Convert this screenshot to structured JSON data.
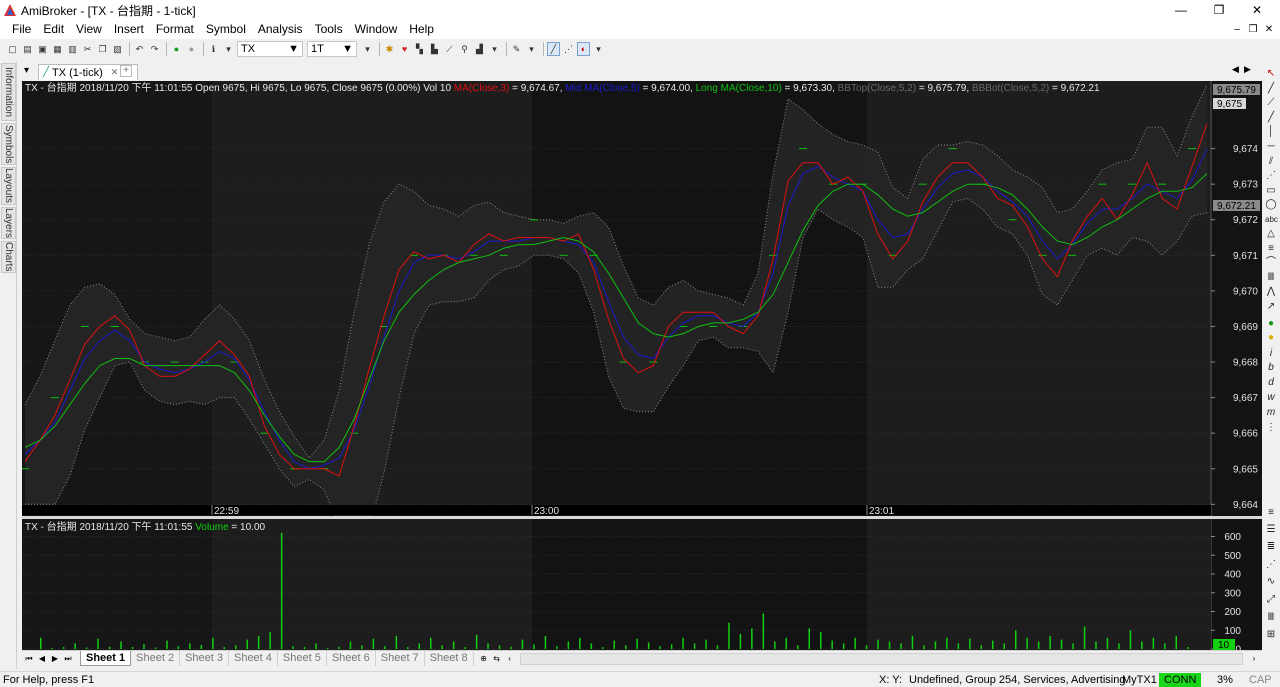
{
  "window": {
    "title": "AmiBroker - [TX - 台指期 - 1-tick]",
    "minimize": "—",
    "restore": "❐",
    "close": "✕"
  },
  "menu": {
    "items": [
      "File",
      "Edit",
      "View",
      "Insert",
      "Format",
      "Symbol",
      "Analysis",
      "Tools",
      "Window",
      "Help"
    ],
    "mdi_min": "–",
    "mdi_restore": "❐",
    "mdi_close": "✕"
  },
  "toolbar": {
    "symbol": "TX",
    "interval": "1T"
  },
  "left_dock": {
    "tabs": [
      "Information",
      "Symbols",
      "Layouts",
      "Layers",
      "Charts"
    ]
  },
  "doc_tab": {
    "label": "TX (1-tick)",
    "close": "✕"
  },
  "chart": {
    "header": {
      "prefix": "TX - 台指期  2018/11/20 下午 11:01:55 Open 9675, Hi 9675, Lo 9675, Close 9675 (0.00%) Vol 10 ",
      "ma_label": "MA(Close,3)",
      "ma_value": " = 9,674.67, ",
      "mid_label": "Mid MA(Close,5)",
      "mid_value": " = 9,674.00, ",
      "long_label": "Long MA(Close,10)",
      "long_value": " = 9,673.30, ",
      "bbtop_label": "BBTop(Close,5,2)",
      "bbtop_value": " = 9,675.79, ",
      "bbbot_label": "BBBot(Close,5,2)",
      "bbbot_value": " = 9,672.21"
    },
    "volume_header": {
      "prefix": "TX - 台指期  2018/11/20 下午  11:01:55  ",
      "label": "Volume",
      "value": " = 10.00"
    },
    "price_ticks": [
      "9,674",
      "9,673",
      "9,672",
      "9,671",
      "9,670",
      "9,669",
      "9,668",
      "9,667",
      "9,666",
      "9,665",
      "9,664"
    ],
    "volume_ticks": [
      "600",
      "500",
      "400",
      "300",
      "200",
      "100",
      "0"
    ],
    "time_labels": [
      "22:59",
      "23:00",
      "23:01"
    ],
    "price_markers": {
      "bbtop": "9,675.79",
      "close": "9,675",
      "bbbot": "9,672.21"
    },
    "volume_marker": "10",
    "colors": {
      "ma": "#e01010",
      "mid": "#1a1ad0",
      "long": "#10c010",
      "bands": "#8a8a8a",
      "volume": "#10d010"
    }
  },
  "sheets": {
    "tabs": [
      "Sheet 1",
      "Sheet 2",
      "Sheet 3",
      "Sheet 4",
      "Sheet 5",
      "Sheet 6",
      "Sheet 7",
      "Sheet 8"
    ],
    "active": "Sheet 1"
  },
  "status": {
    "help": "For Help, press F1",
    "xy": "X:  Y:",
    "info": "Undefined, Group 254, Services, Advertising",
    "account": "MyTX1",
    "conn": "CONN",
    "percent": "3%",
    "caps": "CAP"
  },
  "chart_data": {
    "type": "line",
    "x_labels": [
      "22:59",
      "23:00",
      "23:01"
    ],
    "ylim": [
      9663.7,
      9675.9
    ],
    "series": [
      {
        "name": "MA(Close,3)",
        "values": [
          9665.2,
          9665.8,
          9666.5,
          9667.5,
          9668.5,
          9669.0,
          9669.3,
          9668.9,
          9667.9,
          9667.6,
          9667.6,
          9667.8,
          9668.2,
          9668.6,
          9668.2,
          9667.6,
          9666.2,
          9665.4,
          9665.0,
          9665.0,
          9665.0,
          9664.8,
          9666.2,
          9667.8,
          9669.3,
          9670.6,
          9671.1,
          9670.9,
          9671.0,
          9670.8,
          9671.3,
          9671.6,
          9671.4,
          9671.5,
          9671.5,
          9671.5,
          9671.4,
          9671.6,
          9670.6,
          9669.2,
          9668.1,
          9667.7,
          9667.9,
          9669.0,
          9669.4,
          9669.4,
          9669.4,
          9669.0,
          9668.8,
          9669.3,
          9670.9,
          9673.1,
          9673.6,
          9673.6,
          9673.0,
          9673.2,
          9672.8,
          9671.6,
          9670.9,
          9671.4,
          9672.5,
          9673.2,
          9673.6,
          9673.6,
          9673.2,
          9672.6,
          9672.4,
          9671.8,
          9670.9,
          9670.4,
          9671.4,
          9672.1,
          9672.6,
          9672.0,
          9672.7,
          9673.6,
          9672.6,
          9672.3,
          9673.5,
          9674.7
        ]
      },
      {
        "name": "Mid MA(Close,5)",
        "values": [
          9665.4,
          9665.8,
          9666.3,
          9667.2,
          9668.1,
          9668.6,
          9668.9,
          9668.6,
          9668.0,
          9667.8,
          9667.7,
          9667.8,
          9668.0,
          9668.3,
          9668.1,
          9667.5,
          9666.6,
          9665.8,
          9665.2,
          9665.0,
          9665.1,
          9665.3,
          9666.1,
          9667.3,
          9668.7,
          9670.0,
          9670.8,
          9671.0,
          9671.0,
          9670.9,
          9671.1,
          9671.4,
          9671.4,
          9671.4,
          9671.5,
          9671.5,
          9671.4,
          9671.3,
          9670.8,
          9669.7,
          9668.7,
          9668.2,
          9668.1,
          9668.7,
          9669.1,
          9669.3,
          9669.3,
          9669.1,
          9669.0,
          9669.4,
          9670.5,
          9672.4,
          9673.3,
          9673.5,
          9673.2,
          9673.0,
          9672.8,
          9672.0,
          9671.5,
          9671.6,
          9672.3,
          9672.9,
          9673.3,
          9673.4,
          9673.2,
          9672.8,
          9672.5,
          9672.1,
          9671.4,
          9670.9,
          9671.3,
          9671.9,
          9672.3,
          9672.3,
          9672.6,
          9673.0,
          9672.8,
          9672.6,
          9673.1,
          9674.0
        ]
      },
      {
        "name": "Long MA(Close,10)",
        "values": [
          9665.6,
          9665.8,
          9666.2,
          9666.8,
          9667.4,
          9667.9,
          9668.1,
          9668.1,
          9667.9,
          9667.9,
          9667.9,
          9667.9,
          9667.9,
          9667.9,
          9667.7,
          9667.2,
          9666.5,
          9665.9,
          9665.4,
          9665.2,
          9665.2,
          9665.6,
          9666.4,
          9667.5,
          9668.6,
          9669.4,
          9669.9,
          9670.3,
          9670.6,
          9670.8,
          9670.9,
          9671.0,
          9671.2,
          9671.3,
          9671.3,
          9671.4,
          9671.5,
          9671.4,
          9671.1,
          9670.5,
          9669.8,
          9669.1,
          9668.8,
          9668.7,
          9668.8,
          9669.0,
          9669.1,
          9669.1,
          9669.2,
          9669.4,
          9669.9,
          9670.8,
          9671.7,
          9672.4,
          9672.8,
          9673.0,
          9673.0,
          9672.7,
          9672.3,
          9672.1,
          9672.2,
          9672.5,
          9672.8,
          9673.0,
          9673.0,
          9672.9,
          9672.7,
          9672.3,
          9671.8,
          9671.4,
          9671.3,
          9671.5,
          9671.8,
          9672.0,
          9672.3,
          9672.6,
          9672.8,
          9672.8,
          9672.9,
          9673.3
        ]
      },
      {
        "name": "BBTop(Close,5,2)",
        "values": [
          9666.8,
          9667.6,
          9668.6,
          9669.6,
          9670.1,
          9670.2,
          9669.9,
          9669.2,
          9668.8,
          9668.7,
          9668.6,
          9668.7,
          9669.2,
          9669.6,
          9669.2,
          9668.6,
          9667.5,
          9666.6,
          9665.9,
          9665.3,
          9665.8,
          9667.2,
          9669.4,
          9671.3,
          9672.5,
          9673.0,
          9672.8,
          9672.4,
          9672.3,
          9672.1,
          9672.4,
          9672.5,
          9672.2,
          9672.1,
          9672.0,
          9672.0,
          9671.9,
          9672.1,
          9672.2,
          9671.8,
          9670.7,
          9669.8,
          9669.6,
          9670.1,
          9670.3,
          9670.0,
          9669.9,
          9669.8,
          9669.6,
          9670.5,
          9673.3,
          9675.4,
          9675.1,
          9674.7,
          9674.4,
          9674.2,
          9674.1,
          9673.9,
          9672.9,
          9672.6,
          9673.7,
          9674.1,
          9674.1,
          9674.2,
          9674.1,
          9673.8,
          9673.4,
          9673.2,
          9672.9,
          9672.2,
          9672.3,
          9672.8,
          9673.4,
          9673.6,
          9673.7,
          9674.6,
          9674.6,
          9673.8,
          9674.9,
          9675.8
        ]
      },
      {
        "name": "BBBot(Close,5,2)",
        "values": [
          9664.0,
          9664.0,
          9664.0,
          9664.8,
          9666.1,
          9667.0,
          9667.9,
          9668.0,
          9667.2,
          9666.9,
          9666.8,
          9666.9,
          9666.8,
          9667.0,
          9667.0,
          9666.4,
          9665.7,
          9665.0,
          9664.5,
          9664.7,
          9664.4,
          9663.4,
          9662.8,
          9663.3,
          9664.9,
          9667.0,
          9668.8,
          9669.6,
          9669.7,
          9669.7,
          9669.8,
          9670.3,
          9670.6,
          9670.7,
          9671.0,
          9671.0,
          9670.9,
          9670.5,
          9669.4,
          9667.6,
          9666.7,
          9666.6,
          9666.6,
          9667.3,
          9667.9,
          9668.6,
          9668.7,
          9668.4,
          9668.4,
          9668.3,
          9667.7,
          9669.4,
          9671.5,
          9672.3,
          9672.0,
          9671.8,
          9671.5,
          9670.1,
          9670.1,
          9670.6,
          9670.9,
          9671.7,
          9672.5,
          9672.6,
          9672.3,
          9671.8,
          9671.6,
          9671.0,
          9669.9,
          9669.6,
          9670.3,
          9671.0,
          9671.2,
          9671.0,
          9671.5,
          9671.4,
          9671.0,
          9671.4,
          9672.1,
          9672.2
        ]
      }
    ],
    "volume": {
      "name": "Volume",
      "ylim": [
        0,
        640
      ],
      "values": [
        60,
        5,
        10,
        30,
        8,
        55,
        12,
        40,
        10,
        25,
        8,
        45,
        15,
        30,
        22,
        60,
        10,
        20,
        50,
        70,
        90,
        620,
        15,
        10,
        30,
        5,
        12,
        40,
        20,
        55,
        15,
        70,
        10,
        30,
        60,
        20,
        40,
        10,
        75,
        30,
        20,
        12,
        50,
        25,
        70,
        15,
        40,
        60,
        30,
        10,
        45,
        20,
        55,
        35,
        15,
        25,
        60,
        30,
        50,
        20,
        140,
        80,
        110,
        190,
        40,
        60,
        20,
        110,
        90,
        45,
        30,
        60,
        20,
        50,
        40,
        30,
        70,
        20,
        40,
        60,
        30,
        55,
        20,
        45,
        30,
        100,
        60,
        40,
        70,
        50,
        30,
        120,
        40,
        60,
        30,
        100,
        40,
        60,
        30,
        70,
        10
      ],
      "last": 10
    }
  }
}
